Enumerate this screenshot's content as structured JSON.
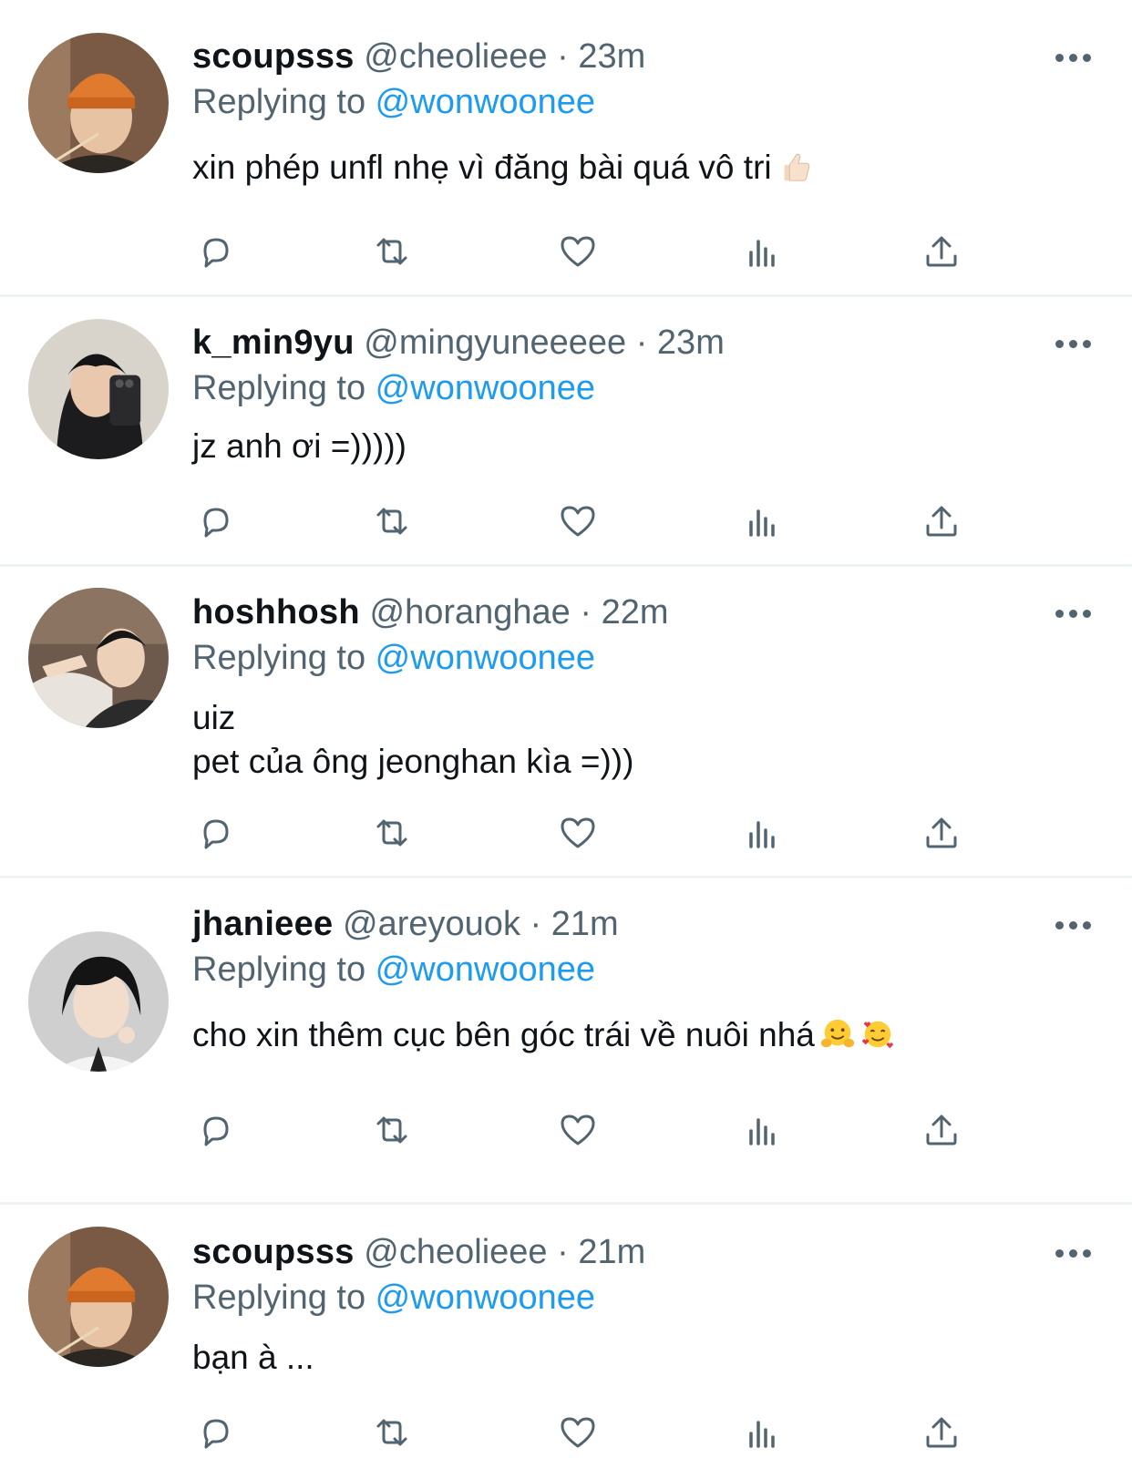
{
  "colors": {
    "text": "#0f1419",
    "secondary": "#536471",
    "accent": "#1d9bf0",
    "divider": "#eff3f4"
  },
  "tweets": [
    {
      "name": "scoupsss",
      "handle": "@cheolieee · 23m",
      "replying_label": "Replying to ",
      "replying_to": "@wonwoonee",
      "text": "xin phép unfl nhẹ vì đăng bài quá vô tri",
      "emojis": [
        "thumbs-up-emoji"
      ]
    },
    {
      "name": "k_min9yu",
      "handle": "@mingyuneeeee · 23m",
      "replying_label": "Replying to ",
      "replying_to": "@wonwoonee",
      "text": "jz anh ơi =)))))",
      "emojis": []
    },
    {
      "name": "hoshhosh",
      "handle": "@horanghae · 22m",
      "replying_label": "Replying to ",
      "replying_to": "@wonwoonee",
      "text": "uiz\npet của ông jeonghan kìa =)))",
      "emojis": []
    },
    {
      "name": "jhanieee",
      "handle": "@areyouok · 21m",
      "replying_label": "Replying to ",
      "replying_to": "@wonwoonee",
      "text": "cho xin thêm cục bên góc trái về nuôi nhá",
      "emojis": [
        "hugging-face-emoji",
        "smiling-face-with-hearts-emoji"
      ]
    },
    {
      "name": "scoupsss",
      "handle": "@cheolieee · 21m",
      "replying_label": "Replying to ",
      "replying_to": "@wonwoonee",
      "text": "bạn à ...",
      "emojis": []
    }
  ],
  "action_icons": [
    "reply-icon",
    "retweet-icon",
    "like-icon",
    "views-icon",
    "share-icon"
  ]
}
